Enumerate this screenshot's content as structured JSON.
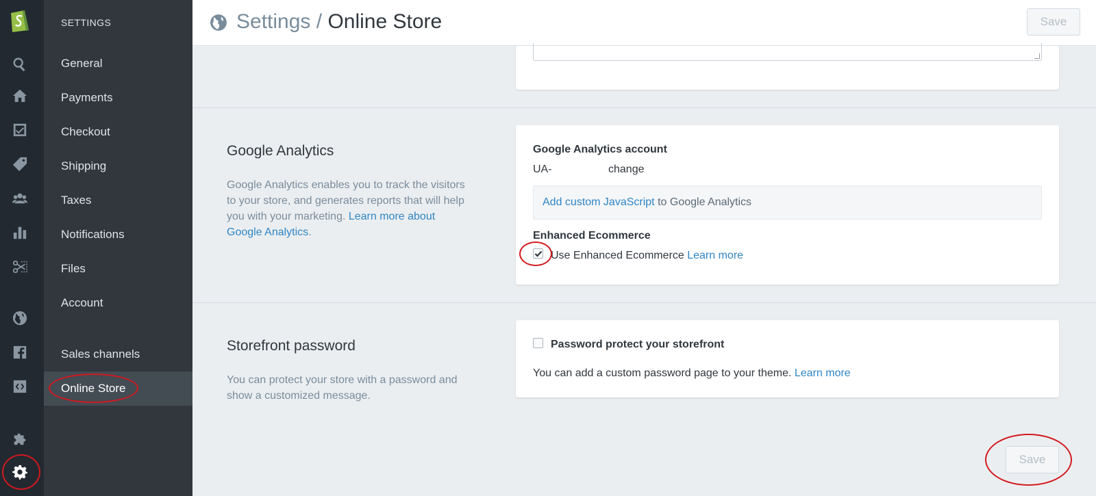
{
  "rail": {
    "icons": [
      "shopify-logo",
      "search-icon",
      "home-icon",
      "orders-icon",
      "tag-icon",
      "customers-icon",
      "reports-icon",
      "discounts-icon",
      "globe-icon",
      "facebook-icon",
      "buy-button-icon",
      "apps-icon",
      "gear-icon"
    ]
  },
  "sidebar": {
    "heading": "SETTINGS",
    "items": [
      {
        "label": "General"
      },
      {
        "label": "Payments"
      },
      {
        "label": "Checkout"
      },
      {
        "label": "Shipping"
      },
      {
        "label": "Taxes"
      },
      {
        "label": "Notifications"
      },
      {
        "label": "Files"
      },
      {
        "label": "Account"
      },
      {
        "label": "Sales channels"
      },
      {
        "label": "Online Store",
        "active": true
      }
    ]
  },
  "header": {
    "crumb_parent": "Settings",
    "separator": "/",
    "crumb_current": "Online Store",
    "save_label": "Save"
  },
  "google_analytics": {
    "title": "Google Analytics",
    "desc": "Google Analytics enables you to track the visitors to your store, and generates reports that will help you with your marketing.",
    "desc_link": "Learn more about Google Analytics",
    "desc_end": ".",
    "account_heading": "Google Analytics account",
    "account_value": "UA-",
    "change_link": "change",
    "js_link": "Add custom JavaScript",
    "js_suffix": "to Google Analytics",
    "enhanced_heading": "Enhanced Ecommerce",
    "enhanced_label": "Use Enhanced Ecommerce",
    "enhanced_checked": true,
    "enhanced_link": "Learn more"
  },
  "storefront": {
    "title": "Storefront password",
    "desc": "You can protect your store with a password and show a customized message.",
    "checkbox_label": "Password protect your storefront",
    "checked": false,
    "note": "You can add a custom password page to your theme.",
    "note_link": "Learn more"
  },
  "footer": {
    "save_label": "Save"
  },
  "colors": {
    "rail_bg": "#222930",
    "sidebar_bg": "#31373d",
    "link": "#2f85c5",
    "annotation": "#d2191f"
  }
}
